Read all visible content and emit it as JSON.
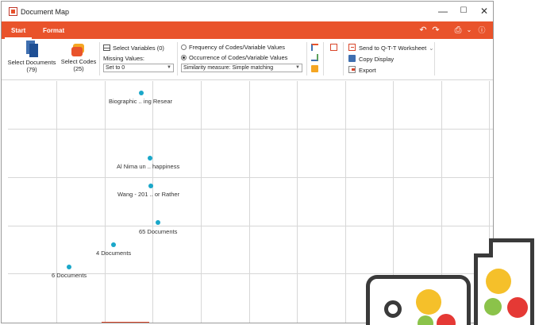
{
  "window": {
    "title": "Document Map",
    "minimize": "—",
    "maximize": "☐",
    "close": "✕"
  },
  "tabs": [
    {
      "label": "Start"
    },
    {
      "label": "Format"
    }
  ],
  "ribbon": {
    "select_documents": {
      "label": "Select Documents",
      "count": "(79)"
    },
    "select_codes": {
      "label": "Select Codes",
      "count": "(25)"
    },
    "select_variables": "Select Variables (0)",
    "missing_values_label": "Missing Values:",
    "missing_values_value": "Set to 0",
    "option_frequency": "Frequency of Codes/Variable Values",
    "option_occurrence": "Occurrence of Codes/Variable Values",
    "similarity_value": "Similarity measure: Simple matching",
    "send_to": "Send to Q-T-T Worksheet",
    "copy_display": "Copy Display",
    "export": "Export"
  },
  "map": {
    "labels": [
      {
        "text": "Biographic .. ing Resear"
      },
      {
        "text": "Al Nima un .. happiness"
      },
      {
        "text": "Wang - 201 .. or Rather"
      },
      {
        "text": "65 Documents"
      },
      {
        "text": "4 Documents"
      },
      {
        "text": "6 Documents"
      }
    ]
  },
  "colors": {
    "accent": "#e9532b",
    "dot": "#1aa7c9",
    "logo_yellow": "#f5c02a",
    "logo_green": "#8bc34a",
    "logo_red": "#e53935",
    "logo_outline": "#3a3a3a"
  }
}
